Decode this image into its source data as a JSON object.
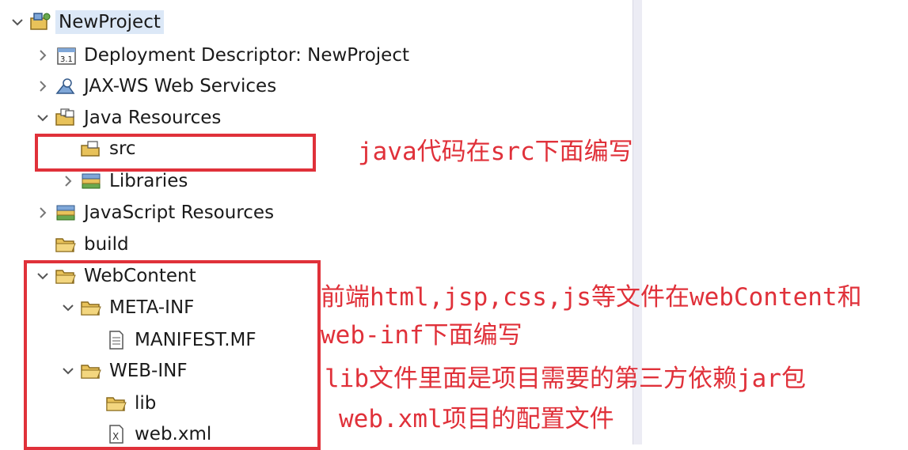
{
  "tree": {
    "project": "NewProject",
    "deployment_descriptor": "Deployment Descriptor: NewProject",
    "jaxws": "JAX-WS Web Services",
    "java_resources": "Java Resources",
    "src": "src",
    "libraries": "Libraries",
    "javascript_resources": "JavaScript Resources",
    "build": "build",
    "webcontent": "WebContent",
    "meta_inf": "META-INF",
    "manifest": "MANIFEST.MF",
    "web_inf": "WEB-INF",
    "lib": "lib",
    "web_xml": "web.xml"
  },
  "annotations": {
    "src_note": "java代码在src下面编写",
    "webcontent_note_line1": "前端html,jsp,css,js等文件在webContent和",
    "webcontent_note_line2": "web-inf下面编写",
    "lib_note": "lib文件里面是项目需要的第三方依赖jar包",
    "webxml_note": "web.xml项目的配置文件"
  },
  "colors": {
    "annotation": "#e0313a",
    "selection": "#dce8f7",
    "folder": "#e8c25a"
  }
}
